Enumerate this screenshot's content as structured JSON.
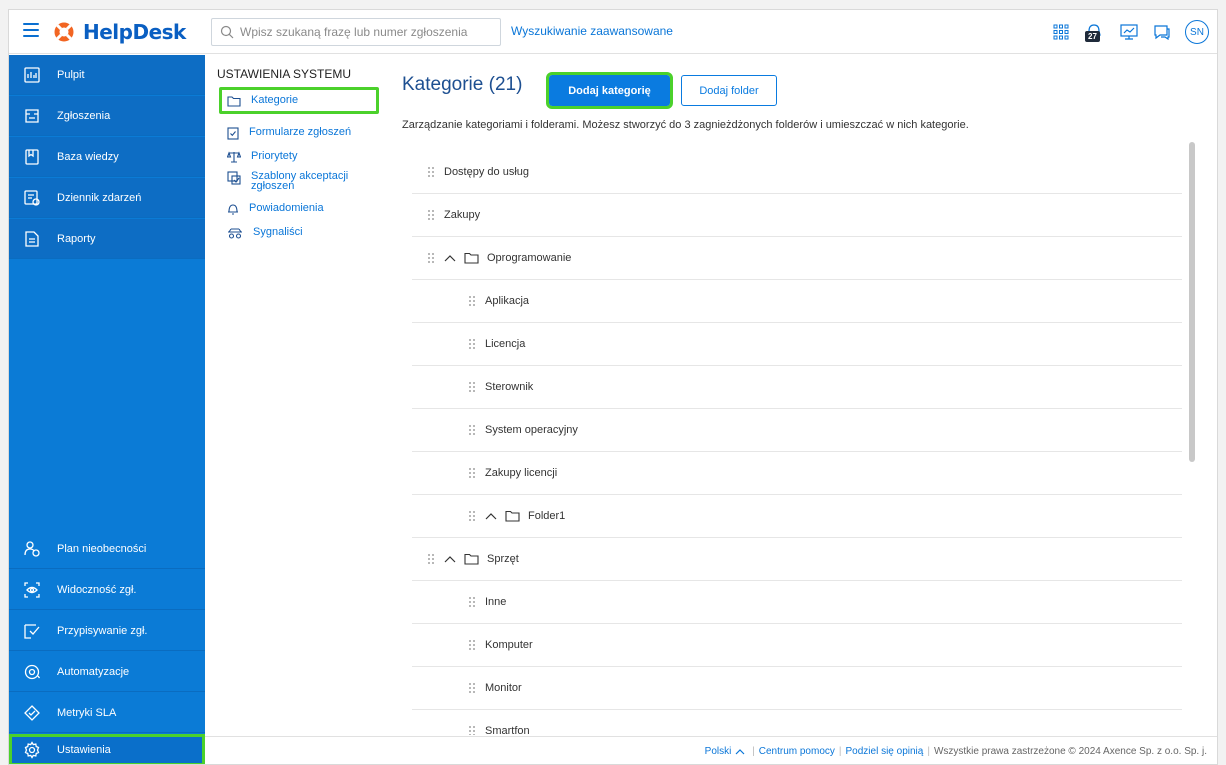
{
  "app": {
    "name": "HelpDesk"
  },
  "search": {
    "placeholder": "Wpisz szukaną frazę lub numer zgłoszenia",
    "advanced_link": "Wyszukiwanie zaawansowane"
  },
  "header": {
    "notifications_count": "27",
    "avatar_initials": "SN"
  },
  "sidebar": {
    "top_items": [
      {
        "label": "Pulpit",
        "icon": "dashboard-icon"
      },
      {
        "label": "Zgłoszenia",
        "icon": "tickets-icon"
      },
      {
        "label": "Baza wiedzy",
        "icon": "knowledge-base-icon"
      },
      {
        "label": "Dziennik zdarzeń",
        "icon": "event-log-icon"
      },
      {
        "label": "Raporty",
        "icon": "reports-icon"
      }
    ],
    "bottom_items": [
      {
        "label": "Plan nieobecności",
        "icon": "absence-plan-icon"
      },
      {
        "label": "Widoczność zgł.",
        "icon": "visibility-icon"
      },
      {
        "label": "Przypisywanie zgł.",
        "icon": "assignment-icon"
      },
      {
        "label": "Automatyzacje",
        "icon": "automation-icon"
      },
      {
        "label": "Metryki SLA",
        "icon": "sla-icon"
      },
      {
        "label": "Ustawienia",
        "icon": "settings-gear-icon",
        "active": true
      }
    ]
  },
  "settings_panel": {
    "title": "USTAWIENIA SYSTEMU",
    "items": [
      {
        "label": "Kategorie",
        "icon": "folder-icon",
        "active": true
      },
      {
        "label": "Formularze zgłoszeń",
        "icon": "form-icon"
      },
      {
        "label": "Priorytety",
        "icon": "scales-icon"
      },
      {
        "label": "Szablony akceptacji zgłoszeń",
        "icon": "approval-template-icon"
      },
      {
        "label": "Powiadomienia",
        "icon": "bell-icon"
      },
      {
        "label": "Sygnaliści",
        "icon": "whistleblower-icon"
      }
    ]
  },
  "main": {
    "title": "Kategorie",
    "count": "(21)",
    "add_category_button": "Dodaj kategorię",
    "add_folder_button": "Dodaj folder",
    "description": "Zarządzanie kategoriami i folderami. Możesz stworzyć do 3 zagnieżdżonych folderów i umieszczać w nich kategorie.",
    "rows": [
      {
        "label": "Dostępy do usług",
        "level": 0,
        "folder": false
      },
      {
        "label": "Zakupy",
        "level": 0,
        "folder": false
      },
      {
        "label": "Oprogramowanie",
        "level": 0,
        "folder": true
      },
      {
        "label": "Aplikacja",
        "level": 1,
        "folder": false
      },
      {
        "label": "Licencja",
        "level": 1,
        "folder": false
      },
      {
        "label": "Sterownik",
        "level": 1,
        "folder": false
      },
      {
        "label": "System operacyjny",
        "level": 1,
        "folder": false
      },
      {
        "label": "Zakupy licencji",
        "level": 1,
        "folder": false
      },
      {
        "label": "Folder1",
        "level": 1,
        "folder": true
      },
      {
        "label": "Sprzęt",
        "level": 0,
        "folder": true
      },
      {
        "label": "Inne",
        "level": 1,
        "folder": false
      },
      {
        "label": "Komputer",
        "level": 1,
        "folder": false
      },
      {
        "label": "Monitor",
        "level": 1,
        "folder": false
      },
      {
        "label": "Smartfon",
        "level": 1,
        "folder": false
      }
    ]
  },
  "footer": {
    "language": "Polski",
    "help_center": "Centrum pomocy",
    "feedback": "Podziel się opinią",
    "copyright": "Wszystkie prawa zastrzeżone © 2024 Axence Sp. z o.o. Sp. j."
  },
  "colors": {
    "brand": "#0b7bd6",
    "accent_highlight": "#4bd12b",
    "link": "#0a76d8"
  }
}
